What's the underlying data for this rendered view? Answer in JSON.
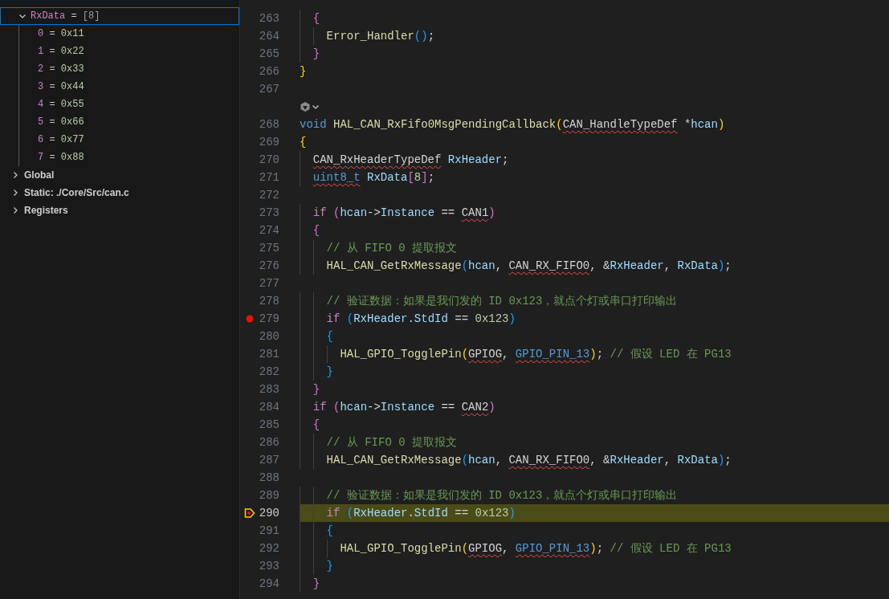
{
  "variables": [
    {
      "name": "RxData",
      "operator": "=",
      "value": "[8]",
      "expanded": true,
      "selected": true,
      "children": [
        {
          "name": "0",
          "operator": "=",
          "value": "0x11",
          "selected": false
        },
        {
          "name": "1",
          "operator": "=",
          "value": "0x22",
          "selected": false
        },
        {
          "name": "2",
          "operator": "=",
          "value": "0x33",
          "selected": false
        },
        {
          "name": "3",
          "operator": "=",
          "value": "0x44",
          "selected": false
        },
        {
          "name": "4",
          "operator": "=",
          "value": "0x55",
          "selected": false
        },
        {
          "name": "5",
          "operator": "=",
          "value": "0x66",
          "selected": false
        },
        {
          "name": "6",
          "operator": "=",
          "value": "0x77",
          "selected": false
        },
        {
          "name": "7",
          "operator": "=",
          "value": "0x88",
          "selected": false
        }
      ]
    }
  ],
  "scopes": [
    {
      "label": "Global",
      "expanded": false
    },
    {
      "label": "Static: ./Core/Src/can.c",
      "expanded": false
    },
    {
      "label": "Registers",
      "expanded": false
    }
  ],
  "lines": [
    {
      "kind": "code",
      "number": "263",
      "breakpoint": false,
      "current": false,
      "tokens": [
        {
          "text": "  {",
          "kind": "bracket2"
        }
      ]
    },
    {
      "kind": "code",
      "number": "264",
      "breakpoint": false,
      "current": false,
      "tokens": [
        {
          "text": "    Error_Handler",
          "kind": "function"
        },
        {
          "text": "()",
          "kind": "bracket3"
        },
        {
          "text": ";",
          "kind": "plain"
        }
      ]
    },
    {
      "kind": "code",
      "number": "265",
      "breakpoint": false,
      "current": false,
      "tokens": [
        {
          "text": "  }",
          "kind": "bracket2"
        }
      ]
    },
    {
      "kind": "code",
      "number": "266",
      "breakpoint": false,
      "current": false,
      "tokens": [
        {
          "text": "}",
          "kind": "bracket1"
        }
      ]
    },
    {
      "kind": "code",
      "number": "267",
      "breakpoint": false,
      "current": false
    },
    {
      "kind": "codelens"
    },
    {
      "kind": "code",
      "number": "268",
      "breakpoint": false,
      "current": false,
      "tokens": [
        {
          "text": "void",
          "kind": "keyword"
        },
        {
          "text": " HAL_CAN_RxFifo0MsgPendingCallback",
          "kind": "function"
        },
        {
          "text": "(",
          "kind": "bracket1"
        },
        {
          "text": "CAN_HandleTypeDef",
          "kind": "plain",
          "error": true
        },
        {
          "text": " *",
          "kind": "plain"
        },
        {
          "text": "hcan",
          "kind": "variable"
        },
        {
          "text": ")",
          "kind": "bracket1"
        }
      ]
    },
    {
      "kind": "code",
      "number": "269",
      "breakpoint": false,
      "current": false,
      "tokens": [
        {
          "text": "{",
          "kind": "bracket1"
        }
      ]
    },
    {
      "kind": "code",
      "number": "270",
      "breakpoint": false,
      "current": false,
      "tokens": [
        {
          "text": "  CAN_RxHeaderTypeDef",
          "kind": "plain",
          "error": true
        },
        {
          "text": " RxHeader",
          "kind": "variable"
        },
        {
          "text": ";",
          "kind": "plain"
        }
      ]
    },
    {
      "kind": "code",
      "number": "271",
      "breakpoint": false,
      "current": false,
      "tokens": [
        {
          "text": "  uint8_t",
          "kind": "keyword",
          "error": true
        },
        {
          "text": " RxData",
          "kind": "variable"
        },
        {
          "text": "[",
          "kind": "bracket2"
        },
        {
          "text": "8",
          "kind": "number"
        },
        {
          "text": "]",
          "kind": "bracket2"
        },
        {
          "text": ";",
          "kind": "plain"
        }
      ]
    },
    {
      "kind": "code",
      "number": "272",
      "breakpoint": false,
      "current": false
    },
    {
      "kind": "code",
      "number": "273",
      "breakpoint": false,
      "current": false,
      "tokens": [
        {
          "text": "  if",
          "kind": "control"
        },
        {
          "text": " (",
          "kind": "bracket2"
        },
        {
          "text": "hcan",
          "kind": "variable"
        },
        {
          "text": "->",
          "kind": "plain"
        },
        {
          "text": "Instance",
          "kind": "variable"
        },
        {
          "text": " ==",
          "kind": "plain"
        },
        {
          "text": " CAN1",
          "kind": "plain",
          "error": true
        },
        {
          "text": ")",
          "kind": "bracket2"
        }
      ]
    },
    {
      "kind": "code",
      "number": "274",
      "breakpoint": false,
      "current": false,
      "tokens": [
        {
          "text": "  {",
          "kind": "bracket2"
        }
      ]
    },
    {
      "kind": "code",
      "number": "275",
      "breakpoint": false,
      "current": false,
      "tokens": [
        {
          "text": "    // 从 FIFO 0 提取报文",
          "kind": "comment"
        }
      ]
    },
    {
      "kind": "code",
      "number": "276",
      "breakpoint": false,
      "current": false,
      "tokens": [
        {
          "text": "    HAL_CAN_GetRxMessage",
          "kind": "function"
        },
        {
          "text": "(",
          "kind": "bracket3"
        },
        {
          "text": "hcan",
          "kind": "variable"
        },
        {
          "text": ",",
          "kind": "plain"
        },
        {
          "text": " CAN_RX_FIFO0",
          "kind": "plain",
          "error": true
        },
        {
          "text": ", &",
          "kind": "plain"
        },
        {
          "text": "RxHeader",
          "kind": "variable"
        },
        {
          "text": ",",
          "kind": "plain"
        },
        {
          "text": " RxData",
          "kind": "variable"
        },
        {
          "text": ")",
          "kind": "bracket3"
        },
        {
          "text": ";",
          "kind": "plain"
        }
      ]
    },
    {
      "kind": "code",
      "number": "277",
      "breakpoint": false,
      "current": false
    },
    {
      "kind": "code",
      "number": "278",
      "breakpoint": false,
      "current": false,
      "tokens": [
        {
          "text": "    // 验证数据：如果是我们发的 ID 0x123，就点个灯或串口打印输出",
          "kind": "comment"
        }
      ]
    },
    {
      "kind": "code",
      "number": "279",
      "breakpoint": true,
      "current": false,
      "tokens": [
        {
          "text": "    if",
          "kind": "control"
        },
        {
          "text": " (",
          "kind": "bracket3"
        },
        {
          "text": "RxHeader",
          "kind": "variable"
        },
        {
          "text": ".",
          "kind": "plain"
        },
        {
          "text": "StdId",
          "kind": "variable"
        },
        {
          "text": " ==",
          "kind": "plain"
        },
        {
          "text": " 0x123",
          "kind": "number"
        },
        {
          "text": ")",
          "kind": "bracket3"
        }
      ]
    },
    {
      "kind": "code",
      "number": "280",
      "breakpoint": false,
      "current": false,
      "tokens": [
        {
          "text": "    {",
          "kind": "bracket3"
        }
      ]
    },
    {
      "kind": "code",
      "number": "281",
      "breakpoint": false,
      "current": false,
      "tokens": [
        {
          "text": "      HAL_GPIO_TogglePin",
          "kind": "function"
        },
        {
          "text": "(",
          "kind": "bracket1"
        },
        {
          "text": "GPIOG",
          "kind": "plain",
          "error": true
        },
        {
          "text": ",",
          "kind": "plain"
        },
        {
          "text": " GPIO_PIN_13",
          "kind": "macro",
          "error": true
        },
        {
          "text": ")",
          "kind": "bracket1"
        },
        {
          "text": ";",
          "kind": "plain"
        },
        {
          "text": " // 假设 LED 在 PG13",
          "kind": "comment"
        }
      ]
    },
    {
      "kind": "code",
      "number": "282",
      "breakpoint": false,
      "current": false,
      "tokens": [
        {
          "text": "    }",
          "kind": "bracket3"
        }
      ]
    },
    {
      "kind": "code",
      "number": "283",
      "breakpoint": false,
      "current": false,
      "tokens": [
        {
          "text": "  }",
          "kind": "bracket2"
        }
      ]
    },
    {
      "kind": "code",
      "number": "284",
      "breakpoint": false,
      "current": false,
      "tokens": [
        {
          "text": "  if",
          "kind": "control"
        },
        {
          "text": " (",
          "kind": "bracket2"
        },
        {
          "text": "hcan",
          "kind": "variable"
        },
        {
          "text": "->",
          "kind": "plain"
        },
        {
          "text": "Instance",
          "kind": "variable"
        },
        {
          "text": " ==",
          "kind": "plain"
        },
        {
          "text": " CAN2",
          "kind": "plain",
          "error": true
        },
        {
          "text": ")",
          "kind": "bracket2"
        }
      ]
    },
    {
      "kind": "code",
      "number": "285",
      "breakpoint": false,
      "current": false,
      "tokens": [
        {
          "text": "  {",
          "kind": "bracket2"
        }
      ]
    },
    {
      "kind": "code",
      "number": "286",
      "breakpoint": false,
      "current": false,
      "tokens": [
        {
          "text": "    // 从 FIFO 0 提取报文",
          "kind": "comment"
        }
      ]
    },
    {
      "kind": "code",
      "number": "287",
      "breakpoint": false,
      "current": false,
      "tokens": [
        {
          "text": "    HAL_CAN_GetRxMessage",
          "kind": "function"
        },
        {
          "text": "(",
          "kind": "bracket3"
        },
        {
          "text": "hcan",
          "kind": "variable"
        },
        {
          "text": ",",
          "kind": "plain"
        },
        {
          "text": " CAN_RX_FIFO0",
          "kind": "plain",
          "error": true
        },
        {
          "text": ", &",
          "kind": "plain"
        },
        {
          "text": "RxHeader",
          "kind": "variable"
        },
        {
          "text": ",",
          "kind": "plain"
        },
        {
          "text": " RxData",
          "kind": "variable"
        },
        {
          "text": ")",
          "kind": "bracket3"
        },
        {
          "text": ";",
          "kind": "plain"
        }
      ]
    },
    {
      "kind": "code",
      "number": "288",
      "breakpoint": false,
      "current": false
    },
    {
      "kind": "code",
      "number": "289",
      "breakpoint": false,
      "current": false,
      "tokens": [
        {
          "text": "    // 验证数据：如果是我们发的 ID 0x123，就点个灯或串口打印输出",
          "kind": "comment"
        }
      ]
    },
    {
      "kind": "code",
      "number": "290",
      "breakpoint": false,
      "current": true,
      "tokens": [
        {
          "text": "    if",
          "kind": "control"
        },
        {
          "text": " (",
          "kind": "bracket3"
        },
        {
          "text": "RxHeader",
          "kind": "variable"
        },
        {
          "text": ".",
          "kind": "plain"
        },
        {
          "text": "StdId",
          "kind": "variable"
        },
        {
          "text": " ==",
          "kind": "plain"
        },
        {
          "text": " 0x123",
          "kind": "number"
        },
        {
          "text": ")",
          "kind": "bracket3"
        }
      ]
    },
    {
      "kind": "code",
      "number": "291",
      "breakpoint": false,
      "current": false,
      "tokens": [
        {
          "text": "    {",
          "kind": "bracket3"
        }
      ]
    },
    {
      "kind": "code",
      "number": "292",
      "breakpoint": false,
      "current": false,
      "tokens": [
        {
          "text": "      HAL_GPIO_TogglePin",
          "kind": "function"
        },
        {
          "text": "(",
          "kind": "bracket1"
        },
        {
          "text": "GPIOG",
          "kind": "plain",
          "error": true
        },
        {
          "text": ",",
          "kind": "plain"
        },
        {
          "text": " GPIO_PIN_13",
          "kind": "macro",
          "error": true
        },
        {
          "text": ")",
          "kind": "bracket1"
        },
        {
          "text": ";",
          "kind": "plain"
        },
        {
          "text": " // 假设 LED 在 PG13",
          "kind": "comment"
        }
      ]
    },
    {
      "kind": "code",
      "number": "293",
      "breakpoint": false,
      "current": false,
      "tokens": [
        {
          "text": "    }",
          "kind": "bracket3"
        }
      ]
    },
    {
      "kind": "code",
      "number": "294",
      "breakpoint": false,
      "current": false,
      "tokens": [
        {
          "text": "  }",
          "kind": "bracket2"
        }
      ]
    }
  ]
}
